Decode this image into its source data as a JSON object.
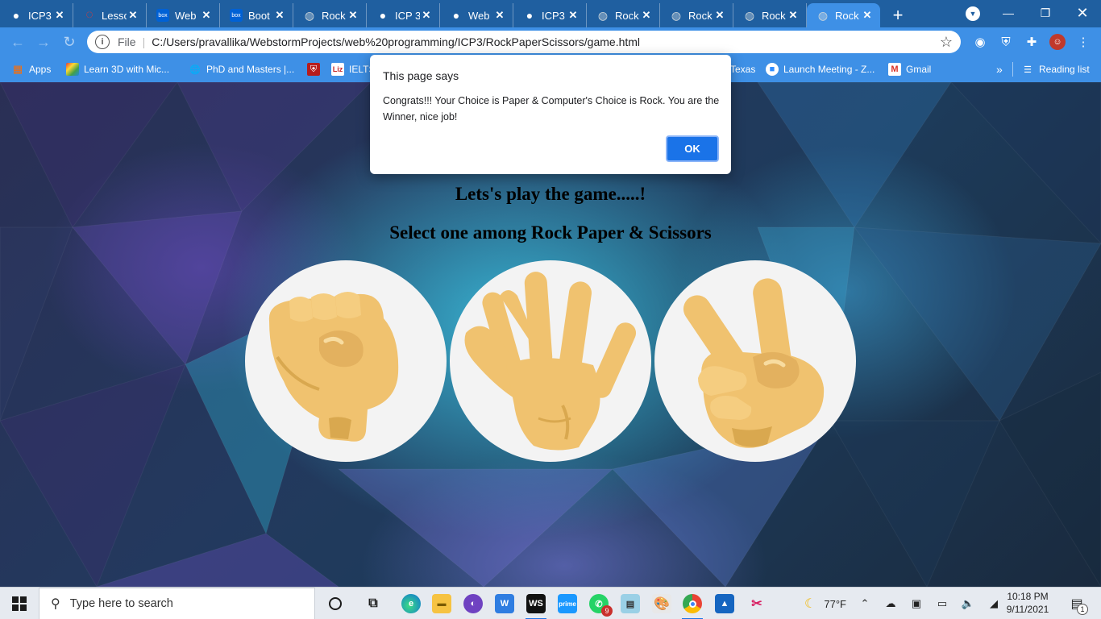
{
  "browser": {
    "tabs": [
      {
        "label": "ICP3",
        "icon": "github-icon",
        "active": false
      },
      {
        "label": "Lesso",
        "icon": "circle-icon",
        "active": false
      },
      {
        "label": "Web",
        "icon": "box-icon",
        "active": false
      },
      {
        "label": "Boot",
        "icon": "box-icon",
        "active": false
      },
      {
        "label": "Rock",
        "icon": "globe-icon",
        "active": false
      },
      {
        "label": "ICP 3",
        "icon": "github-icon",
        "active": false
      },
      {
        "label": "Web",
        "icon": "github-icon",
        "active": false
      },
      {
        "label": "ICP3",
        "icon": "github-icon",
        "active": false
      },
      {
        "label": "Rock",
        "icon": "globe-icon",
        "active": false
      },
      {
        "label": "Rock",
        "icon": "globe-icon",
        "active": false
      },
      {
        "label": "Rock",
        "icon": "globe-icon",
        "active": false
      },
      {
        "label": "Rock",
        "icon": "globe-icon",
        "active": true
      }
    ],
    "new_tab": "+",
    "close_glyph": "✕",
    "address": {
      "scheme_label": "File",
      "url": "C:/Users/pravallika/WebstormProjects/web%20programming/ICP3/RockPaperScissors/game.html"
    },
    "bookmarks": [
      {
        "label": "Apps",
        "icon": "apps-grid-icon"
      },
      {
        "label": "Learn 3D with Mic...",
        "icon": "colorful-grid-icon"
      },
      {
        "label": "PhD and Masters |...",
        "icon": "globe-icon"
      },
      {
        "label": "",
        "icon": "shield-icon"
      },
      {
        "label": "IELTS",
        "icon": "liz-icon"
      },
      {
        "label": "Texas",
        "icon": "globe-icon"
      },
      {
        "label": "Launch Meeting - Z...",
        "icon": "zoom-icon"
      },
      {
        "label": "Gmail",
        "icon": "gmail-icon"
      }
    ],
    "bookmarks_more": "»",
    "reading_list": "Reading list"
  },
  "page": {
    "heading": "Lets's play the game.....!",
    "subheading": "Select one among Rock Paper & Scissors",
    "choices": [
      {
        "name": "Rock",
        "icon": "fist-icon"
      },
      {
        "name": "Paper",
        "icon": "open-hand-icon"
      },
      {
        "name": "Scissors",
        "icon": "victory-hand-icon"
      }
    ]
  },
  "dialog": {
    "title": "This page says",
    "message": "Congrats!!!  Your Choice is Paper & Computer's Choice is Rock. You are the Winner, nice job!",
    "ok_label": "OK"
  },
  "taskbar": {
    "search_placeholder": "Type here to search",
    "weather": "77°F",
    "time": "10:18 PM",
    "date": "9/11/2021",
    "notification_count": "9",
    "action_center_count": "1"
  },
  "colors": {
    "tab_strip": "#1f5fa0",
    "active_tab": "#3e90e6",
    "dialog_ok": "#1a73e8",
    "hand": "#f0c26f",
    "hand_shadow": "#d9a84f"
  }
}
